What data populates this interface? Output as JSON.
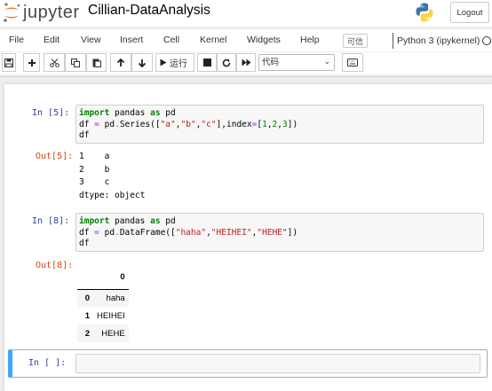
{
  "header": {
    "logo_text": "jupyter",
    "notebook_title": "Cillian-DataAnalysis",
    "logout_label": "Logout"
  },
  "menubar": {
    "items": [
      "File",
      "Edit",
      "View",
      "Insert",
      "Cell",
      "Kernel",
      "Widgets",
      "Help"
    ],
    "trusted_label": "可信",
    "kernel_name": "Python 3 (ipykernel)"
  },
  "toolbar": {
    "run_label": "运行",
    "cell_type": "代码"
  },
  "cells": [
    {
      "in_prompt": "In  [5]:",
      "code_lines": [
        "import pandas as pd",
        "df = pd.Series([\"a\",\"b\",\"c\"],index=[1,2,3])",
        "df"
      ],
      "out_prompt": "Out[5]:",
      "output_lines": [
        "1    a",
        "2    b",
        "3    c",
        "dtype: object"
      ]
    },
    {
      "in_prompt": "In  [8]:",
      "code_lines": [
        "import pandas as pd",
        "df = pd.DataFrame([\"haha\",\"HEIHEI\",\"HEHE\"])",
        "df"
      ],
      "out_prompt": "Out[8]:",
      "table": {
        "columns": [
          "",
          "0"
        ],
        "rows": [
          [
            "0",
            "haha"
          ],
          [
            "1",
            "HEIHEI"
          ],
          [
            "2",
            "HEHE"
          ]
        ]
      }
    },
    {
      "in_prompt": "In  [ ]:"
    }
  ]
}
